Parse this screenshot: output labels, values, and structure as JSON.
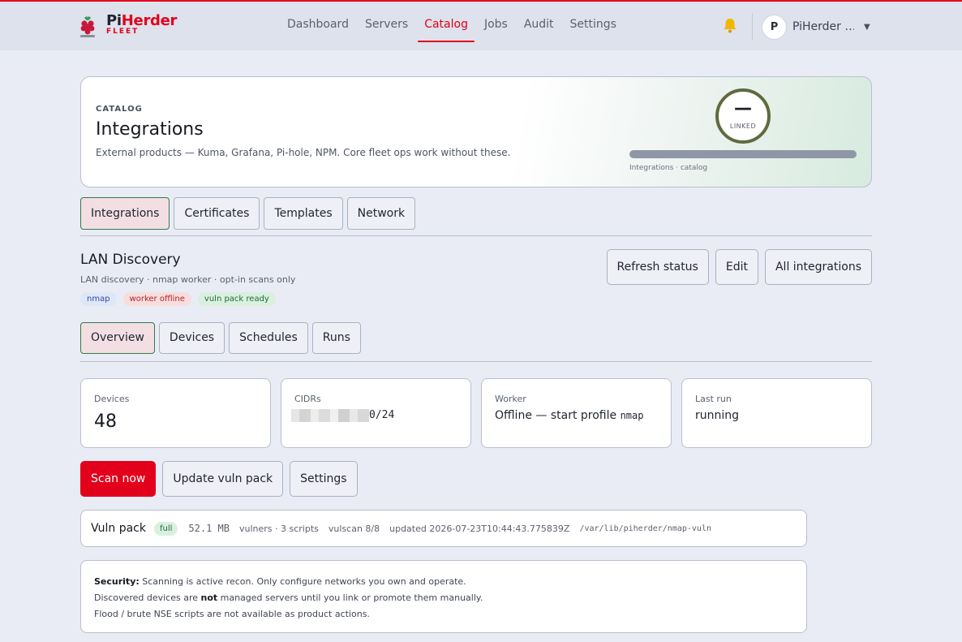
{
  "brand": {
    "name_prefix": "Pi",
    "name_suffix": "Herder",
    "sub": "FLEET"
  },
  "nav": [
    {
      "label": "Dashboard",
      "active": false
    },
    {
      "label": "Servers",
      "active": false
    },
    {
      "label": "Catalog",
      "active": true
    },
    {
      "label": "Jobs",
      "active": false
    },
    {
      "label": "Audit",
      "active": false
    },
    {
      "label": "Settings",
      "active": false
    }
  ],
  "user": {
    "initial": "P",
    "name": "PiHerder …"
  },
  "hero": {
    "eyebrow": "CATALOG",
    "title": "Integrations",
    "description": "External products — Kuma, Grafana, Pi-hole, NPM. Core fleet ops work without these.",
    "ring_value": "—",
    "ring_label": "LINKED",
    "progress_caption": "Integrations · catalog"
  },
  "main_tabs": [
    {
      "label": "Integrations",
      "active": true
    },
    {
      "label": "Certificates",
      "active": false
    },
    {
      "label": "Templates",
      "active": false
    },
    {
      "label": "Network",
      "active": false
    }
  ],
  "section": {
    "title": "LAN Discovery",
    "subtitle": "LAN discovery · nmap worker · opt-in scans only",
    "badges": [
      {
        "label": "nmap",
        "tone": "blue"
      },
      {
        "label": "worker offline",
        "tone": "red"
      },
      {
        "label": "vuln pack ready",
        "tone": "green"
      }
    ],
    "actions": [
      "Refresh status",
      "Edit",
      "All integrations"
    ]
  },
  "sub_tabs": [
    {
      "label": "Overview",
      "active": true
    },
    {
      "label": "Devices",
      "active": false
    },
    {
      "label": "Schedules",
      "active": false
    },
    {
      "label": "Runs",
      "active": false
    }
  ],
  "stats": {
    "devices": {
      "label": "Devices",
      "value": "48"
    },
    "cidrs": {
      "label": "CIDRs",
      "value_tail": "0/24"
    },
    "worker": {
      "label": "Worker",
      "value_prefix": "Offline — start profile ",
      "value_code": "nmap"
    },
    "last_run": {
      "label": "Last run",
      "value": "running"
    }
  },
  "run_buttons": {
    "scan": "Scan now",
    "update": "Update vuln pack",
    "settings": "Settings"
  },
  "vuln_pack": {
    "title": "Vuln pack",
    "status": "full",
    "size": "52.1 MB",
    "scripts": "vulners · 3 scripts",
    "vulscan": "vulscan 8/8",
    "updated": "updated 2026-07-23T10:44:43.775839Z",
    "path": "/var/lib/piherder/nmap-vuln"
  },
  "security_note": {
    "label": "Security:",
    "line1": " Scanning is active recon. Only configure networks you own and operate.",
    "line2_a": "Discovered devices are ",
    "line2_b": "not",
    "line2_c": " managed servers until you link or promote them manually.",
    "line3": "Flood / brute NSE scripts are not available as product actions."
  },
  "colors": {
    "accent": "#e3001b",
    "active_tab_bg": "#f3dfe3",
    "active_tab_border": "#2f7a4a"
  },
  "icons": {
    "logo": "raspberry-logo-icon",
    "notifications": "bell-icon",
    "user_menu": "chevron-down-icon"
  }
}
